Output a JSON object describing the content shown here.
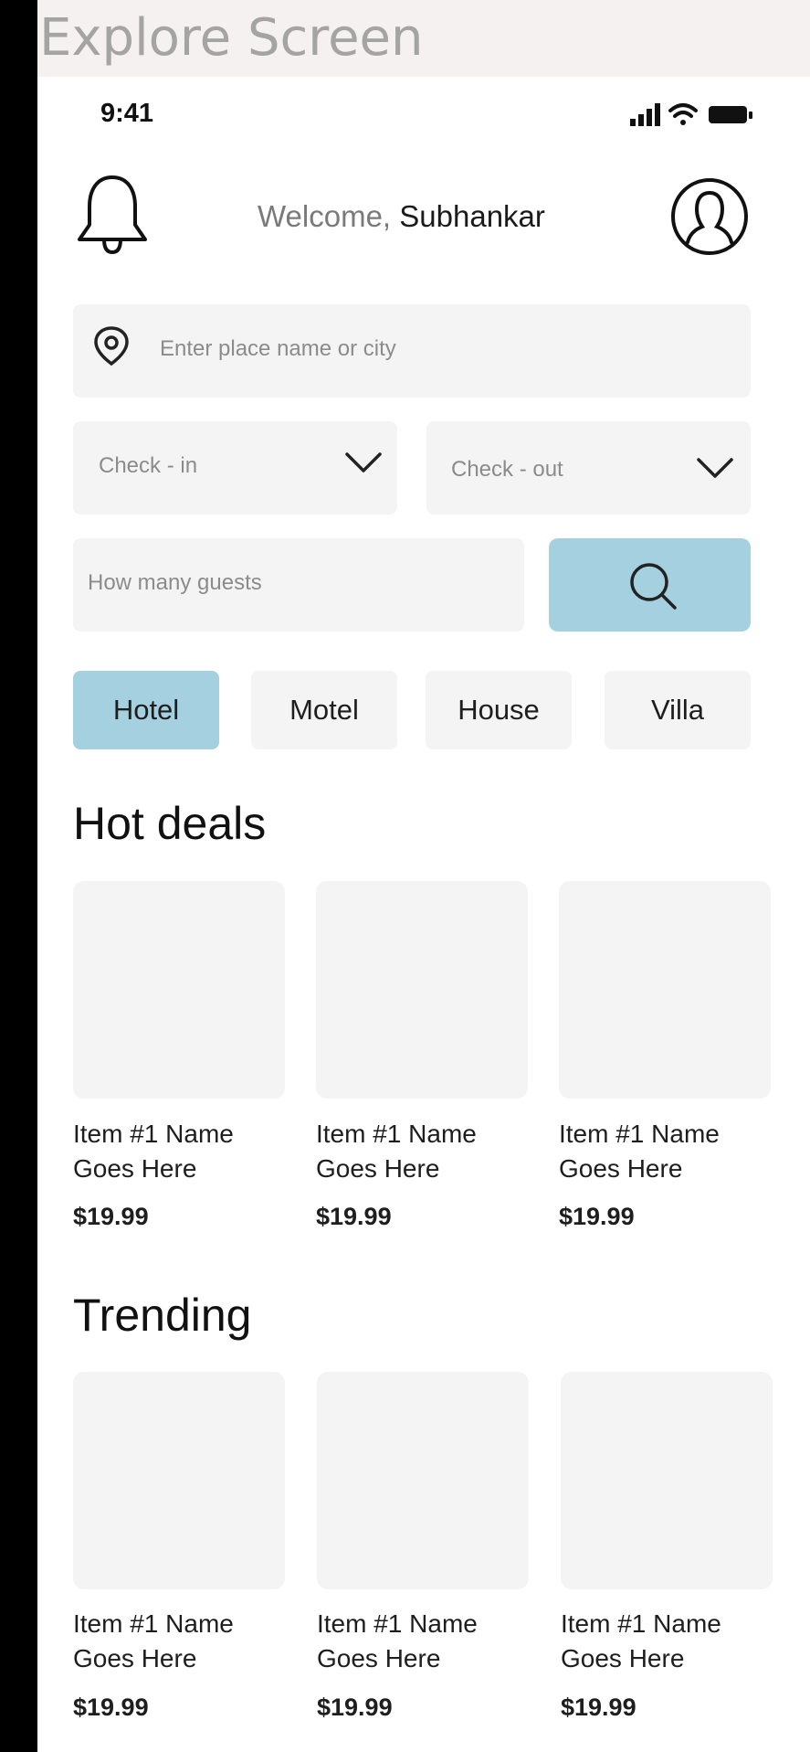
{
  "frame": {
    "title": "Explore Screen"
  },
  "status_bar": {
    "time": "9:41",
    "icons": [
      "signal-icon",
      "wifi-icon",
      "battery-icon"
    ]
  },
  "header": {
    "welcome_prefix": "Welcome,",
    "user_name": "Subhankar"
  },
  "search": {
    "place_placeholder": "Enter place name or city",
    "checkin_placeholder": "Check - in",
    "checkout_placeholder": "Check - out",
    "guests_placeholder": "How many guests"
  },
  "categories": [
    {
      "label": "Hotel",
      "active": true
    },
    {
      "label": "Motel",
      "active": false
    },
    {
      "label": "House",
      "active": false
    },
    {
      "label": "Villa",
      "active": false
    }
  ],
  "hot_deals": {
    "title": "Hot deals",
    "items": [
      {
        "name_line1": "Item #1 Name",
        "name_line2": "Goes Here",
        "price": "$19.99"
      },
      {
        "name_line1": "Item #1 Name",
        "name_line2": "Goes Here",
        "price": "$19.99"
      },
      {
        "name_line1": "Item #1 Name",
        "name_line2": "Goes Here",
        "price": "$19.99"
      }
    ]
  },
  "trending": {
    "title": "Trending",
    "items": [
      {
        "name_line1": "Item #1 Name",
        "name_line2": "Goes Here",
        "price": "$19.99"
      },
      {
        "name_line1": "Item #1 Name",
        "name_line2": "Goes Here",
        "price": "$19.99"
      },
      {
        "name_line1": "Item #1 Name",
        "name_line2": "Goes Here",
        "price": "$19.99"
      }
    ]
  },
  "colors": {
    "accent": "#a4d0e0",
    "field_bg": "#f4f4f4",
    "text": "#1e1e1e",
    "placeholder": "#8b8b8b"
  }
}
